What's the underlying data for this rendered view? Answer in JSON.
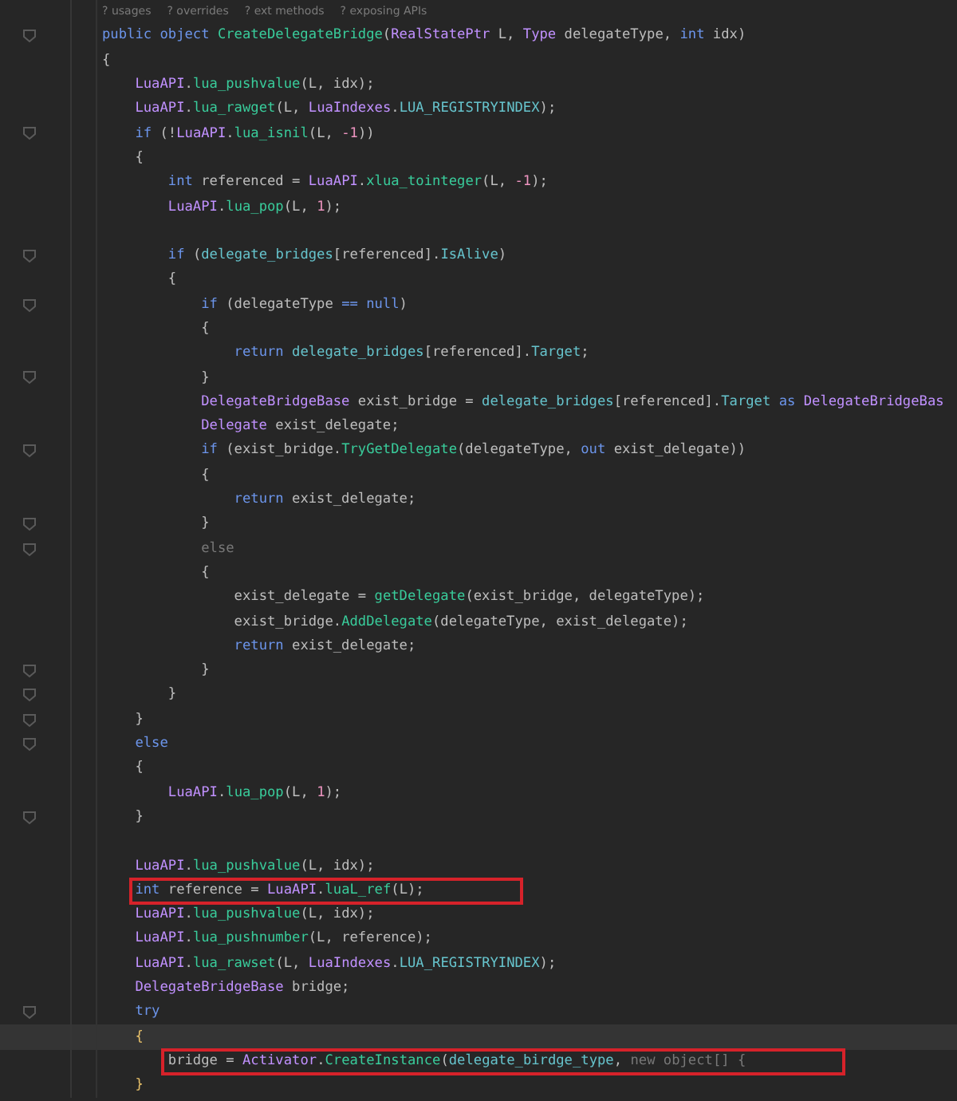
{
  "hints": [
    "? usages",
    "? overrides",
    "? ext methods",
    "? exposing APIs"
  ],
  "lines": [
    {
      "fold": true,
      "boxed": false,
      "current": false,
      "tokens": [
        {
          "kind": "kw",
          "text": "public object "
        },
        {
          "kind": "method",
          "text": "CreateDelegateBridge"
        },
        {
          "kind": "p",
          "text": "("
        },
        {
          "kind": "type",
          "text": "RealStatePtr"
        },
        {
          "kind": "p",
          "text": " L, "
        },
        {
          "kind": "type",
          "text": "Type"
        },
        {
          "kind": "p",
          "text": " delegateType, "
        },
        {
          "kind": "kw",
          "text": "int"
        },
        {
          "kind": "p",
          "text": " idx)"
        }
      ]
    },
    {
      "fold": false,
      "boxed": false,
      "current": false,
      "tokens": [
        {
          "kind": "p",
          "text": "{"
        }
      ]
    },
    {
      "fold": false,
      "boxed": false,
      "current": false,
      "tokens": [
        {
          "kind": "type",
          "text": "    LuaAPI"
        },
        {
          "kind": "p",
          "text": "."
        },
        {
          "kind": "method",
          "text": "lua_pushvalue"
        },
        {
          "kind": "p",
          "text": "(L, idx);"
        }
      ]
    },
    {
      "fold": false,
      "boxed": false,
      "current": false,
      "tokens": [
        {
          "kind": "type",
          "text": "    LuaAPI"
        },
        {
          "kind": "p",
          "text": "."
        },
        {
          "kind": "method",
          "text": "lua_rawget"
        },
        {
          "kind": "p",
          "text": "(L, "
        },
        {
          "kind": "type",
          "text": "LuaIndexes"
        },
        {
          "kind": "p",
          "text": "."
        },
        {
          "kind": "field",
          "text": "LUA_REGISTRYINDEX"
        },
        {
          "kind": "p",
          "text": ");"
        }
      ]
    },
    {
      "fold": true,
      "boxed": false,
      "current": false,
      "tokens": [
        {
          "kind": "kw",
          "text": "    if"
        },
        {
          "kind": "p",
          "text": " (!"
        },
        {
          "kind": "type",
          "text": "LuaAPI"
        },
        {
          "kind": "p",
          "text": "."
        },
        {
          "kind": "method",
          "text": "lua_isnil"
        },
        {
          "kind": "p",
          "text": "(L, "
        },
        {
          "kind": "num",
          "text": "-1"
        },
        {
          "kind": "p",
          "text": "))"
        }
      ]
    },
    {
      "fold": false,
      "boxed": false,
      "current": false,
      "tokens": [
        {
          "kind": "p",
          "text": "    {"
        }
      ]
    },
    {
      "fold": false,
      "boxed": false,
      "current": false,
      "tokens": [
        {
          "kind": "kw",
          "text": "        int"
        },
        {
          "kind": "p",
          "text": " referenced = "
        },
        {
          "kind": "type",
          "text": "LuaAPI"
        },
        {
          "kind": "p",
          "text": "."
        },
        {
          "kind": "method",
          "text": "xlua_tointeger"
        },
        {
          "kind": "p",
          "text": "(L, "
        },
        {
          "kind": "num",
          "text": "-1"
        },
        {
          "kind": "p",
          "text": ");"
        }
      ]
    },
    {
      "fold": false,
      "boxed": false,
      "current": false,
      "tokens": [
        {
          "kind": "type",
          "text": "        LuaAPI"
        },
        {
          "kind": "p",
          "text": "."
        },
        {
          "kind": "method",
          "text": "lua_pop"
        },
        {
          "kind": "p",
          "text": "(L, "
        },
        {
          "kind": "num",
          "text": "1"
        },
        {
          "kind": "p",
          "text": ");"
        }
      ]
    },
    {
      "fold": false,
      "boxed": false,
      "current": false
    },
    {
      "fold": true,
      "boxed": false,
      "current": false,
      "tokens": [
        {
          "kind": "kw",
          "text": "        if"
        },
        {
          "kind": "p",
          "text": " ("
        },
        {
          "kind": "field",
          "text": "delegate_bridges"
        },
        {
          "kind": "p",
          "text": "[referenced]."
        },
        {
          "kind": "field",
          "text": "IsAlive"
        },
        {
          "kind": "p",
          "text": ")"
        }
      ]
    },
    {
      "fold": false,
      "boxed": false,
      "current": false,
      "tokens": [
        {
          "kind": "p",
          "text": "        {"
        }
      ]
    },
    {
      "fold": true,
      "boxed": false,
      "current": false,
      "tokens": [
        {
          "kind": "kw",
          "text": "            if"
        },
        {
          "kind": "p",
          "text": " (delegateType "
        },
        {
          "kind": "kw",
          "text": "== null"
        },
        {
          "kind": "p",
          "text": ")"
        }
      ]
    },
    {
      "fold": false,
      "boxed": false,
      "current": false,
      "tokens": [
        {
          "kind": "p",
          "text": "            {"
        }
      ]
    },
    {
      "fold": false,
      "boxed": false,
      "current": false,
      "tokens": [
        {
          "kind": "kw",
          "text": "                return "
        },
        {
          "kind": "field",
          "text": "delegate_bridges"
        },
        {
          "kind": "p",
          "text": "[referenced]."
        },
        {
          "kind": "field",
          "text": "Target"
        },
        {
          "kind": "p",
          "text": ";"
        }
      ]
    },
    {
      "fold": true,
      "boxed": false,
      "current": false,
      "tokens": [
        {
          "kind": "p",
          "text": "            }"
        }
      ]
    },
    {
      "fold": false,
      "boxed": false,
      "current": false,
      "tokens": [
        {
          "kind": "type",
          "text": "            DelegateBridgeBase"
        },
        {
          "kind": "p",
          "text": " exist_bridge = "
        },
        {
          "kind": "field",
          "text": "delegate_bridges"
        },
        {
          "kind": "p",
          "text": "[referenced]."
        },
        {
          "kind": "field",
          "text": "Target"
        },
        {
          "kind": "kw",
          "text": " as "
        },
        {
          "kind": "type",
          "text": "DelegateBridgeBas"
        }
      ]
    },
    {
      "fold": false,
      "boxed": false,
      "current": false,
      "tokens": [
        {
          "kind": "type",
          "text": "            Delegate"
        },
        {
          "kind": "p",
          "text": " exist_delegate;"
        }
      ]
    },
    {
      "fold": true,
      "boxed": false,
      "current": false,
      "tokens": [
        {
          "kind": "kw",
          "text": "            if"
        },
        {
          "kind": "p",
          "text": " (exist_bridge."
        },
        {
          "kind": "method",
          "text": "TryGetDelegate"
        },
        {
          "kind": "p",
          "text": "(delegateType, "
        },
        {
          "kind": "kw",
          "text": "out"
        },
        {
          "kind": "p",
          "text": " exist_delegate))"
        }
      ]
    },
    {
      "fold": false,
      "boxed": false,
      "current": false,
      "tokens": [
        {
          "kind": "p",
          "text": "            {"
        }
      ]
    },
    {
      "fold": false,
      "boxed": false,
      "current": false,
      "tokens": [
        {
          "kind": "kw",
          "text": "                return"
        },
        {
          "kind": "p",
          "text": " exist_delegate;"
        }
      ]
    },
    {
      "fold": true,
      "boxed": false,
      "current": false,
      "tokens": [
        {
          "kind": "p",
          "text": "            }"
        }
      ]
    },
    {
      "fold": true,
      "boxed": false,
      "current": false,
      "tokens": [
        {
          "kind": "dim",
          "text": "            else"
        }
      ]
    },
    {
      "fold": false,
      "boxed": false,
      "current": false,
      "tokens": [
        {
          "kind": "p",
          "text": "            {"
        }
      ]
    },
    {
      "fold": false,
      "boxed": false,
      "current": false,
      "tokens": [
        {
          "kind": "p",
          "text": "                exist_delegate = "
        },
        {
          "kind": "method",
          "text": "getDelegate"
        },
        {
          "kind": "p",
          "text": "(exist_bridge, delegateType);"
        }
      ]
    },
    {
      "fold": false,
      "boxed": false,
      "current": false,
      "tokens": [
        {
          "kind": "p",
          "text": "                exist_bridge."
        },
        {
          "kind": "method",
          "text": "AddDelegate"
        },
        {
          "kind": "p",
          "text": "(delegateType, exist_delegate);"
        }
      ]
    },
    {
      "fold": false,
      "boxed": false,
      "current": false,
      "tokens": [
        {
          "kind": "kw",
          "text": "                return"
        },
        {
          "kind": "p",
          "text": " exist_delegate;"
        }
      ]
    },
    {
      "fold": true,
      "boxed": false,
      "current": false,
      "tokens": [
        {
          "kind": "p",
          "text": "            }"
        }
      ]
    },
    {
      "fold": true,
      "boxed": false,
      "current": false,
      "tokens": [
        {
          "kind": "p",
          "text": "        }"
        }
      ]
    },
    {
      "fold": true,
      "boxed": false,
      "current": false,
      "tokens": [
        {
          "kind": "p",
          "text": "    }"
        }
      ]
    },
    {
      "fold": true,
      "boxed": false,
      "current": false,
      "tokens": [
        {
          "kind": "kw",
          "text": "    else"
        }
      ]
    },
    {
      "fold": false,
      "boxed": false,
      "current": false,
      "tokens": [
        {
          "kind": "p",
          "text": "    {"
        }
      ]
    },
    {
      "fold": false,
      "boxed": false,
      "current": false,
      "tokens": [
        {
          "kind": "type",
          "text": "        LuaAPI"
        },
        {
          "kind": "p",
          "text": "."
        },
        {
          "kind": "method",
          "text": "lua_pop"
        },
        {
          "kind": "p",
          "text": "(L, "
        },
        {
          "kind": "num",
          "text": "1"
        },
        {
          "kind": "p",
          "text": ");"
        }
      ]
    },
    {
      "fold": true,
      "boxed": false,
      "current": false,
      "tokens": [
        {
          "kind": "p",
          "text": "    }"
        }
      ]
    },
    {
      "fold": false,
      "boxed": false,
      "current": false
    },
    {
      "fold": false,
      "boxed": false,
      "current": false,
      "tokens": [
        {
          "kind": "type",
          "text": "    LuaAPI"
        },
        {
          "kind": "p",
          "text": "."
        },
        {
          "kind": "method",
          "text": "lua_pushvalue"
        },
        {
          "kind": "p",
          "text": "(L, idx);"
        }
      ]
    },
    {
      "fold": false,
      "boxed": true,
      "current": false,
      "tokens": [
        {
          "kind": "kw",
          "text": "    int"
        },
        {
          "kind": "p",
          "text": " reference = "
        },
        {
          "kind": "type",
          "text": "LuaAPI"
        },
        {
          "kind": "p",
          "text": "."
        },
        {
          "kind": "method",
          "text": "luaL_ref"
        },
        {
          "kind": "p",
          "text": "(L);"
        }
      ]
    },
    {
      "fold": false,
      "boxed": false,
      "current": false,
      "tokens": [
        {
          "kind": "type",
          "text": "    LuaAPI"
        },
        {
          "kind": "p",
          "text": "."
        },
        {
          "kind": "method",
          "text": "lua_pushvalue"
        },
        {
          "kind": "p",
          "text": "(L, idx);"
        }
      ]
    },
    {
      "fold": false,
      "boxed": false,
      "current": false,
      "tokens": [
        {
          "kind": "type",
          "text": "    LuaAPI"
        },
        {
          "kind": "p",
          "text": "."
        },
        {
          "kind": "method",
          "text": "lua_pushnumber"
        },
        {
          "kind": "p",
          "text": "(L, reference);"
        }
      ]
    },
    {
      "fold": false,
      "boxed": false,
      "current": false,
      "tokens": [
        {
          "kind": "type",
          "text": "    LuaAPI"
        },
        {
          "kind": "p",
          "text": "."
        },
        {
          "kind": "method",
          "text": "lua_rawset"
        },
        {
          "kind": "p",
          "text": "(L, "
        },
        {
          "kind": "type",
          "text": "LuaIndexes"
        },
        {
          "kind": "p",
          "text": "."
        },
        {
          "kind": "field",
          "text": "LUA_REGISTRYINDEX"
        },
        {
          "kind": "p",
          "text": ");"
        }
      ]
    },
    {
      "fold": false,
      "boxed": false,
      "current": false,
      "tokens": [
        {
          "kind": "type",
          "text": "    DelegateBridgeBase"
        },
        {
          "kind": "p",
          "text": " bridge;"
        }
      ]
    },
    {
      "fold": true,
      "boxed": false,
      "current": false,
      "tokens": [
        {
          "kind": "kw",
          "text": "    try"
        }
      ]
    },
    {
      "fold": false,
      "boxed": false,
      "current": true,
      "tokens": [
        {
          "kind": "brace",
          "text": "    {"
        }
      ]
    },
    {
      "fold": false,
      "boxed": true,
      "current": false,
      "tokens": [
        {
          "kind": "p",
          "text": "        bridge = "
        },
        {
          "kind": "type",
          "text": "Activator"
        },
        {
          "kind": "p",
          "text": "."
        },
        {
          "kind": "method",
          "text": "CreateInstance"
        },
        {
          "kind": "p",
          "text": "("
        },
        {
          "kind": "field",
          "text": "delegate_birdge_type"
        },
        {
          "kind": "p",
          "text": ", "
        },
        {
          "kind": "dim",
          "text": "new object[] {"
        }
      ]
    },
    {
      "fold": false,
      "boxed": false,
      "current": false,
      "tokens": [
        {
          "kind": "brace",
          "text": "    }"
        }
      ]
    }
  ]
}
